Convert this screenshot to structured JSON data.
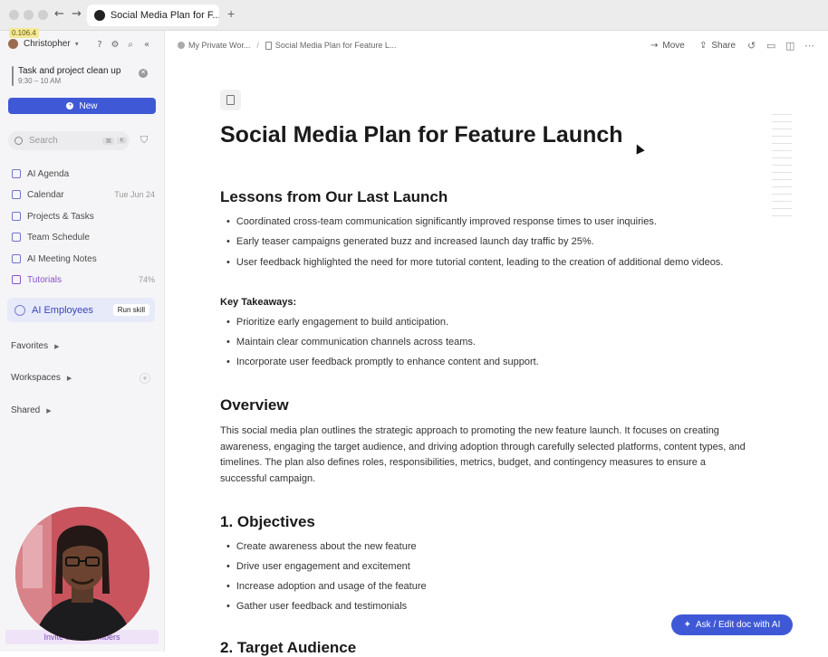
{
  "window": {
    "tab_title": "Social Media Plan for F..."
  },
  "sidebar": {
    "version": "0.106.4",
    "user_name": "Christopher",
    "event": {
      "title": "Task and project clean up",
      "time": "9:30 – 10 AM"
    },
    "new_button": "New",
    "search": {
      "placeholder": "Search",
      "kbd1": "⌘",
      "kbd2": "K"
    },
    "nav": [
      {
        "label": "AI Agenda",
        "meta": ""
      },
      {
        "label": "Calendar",
        "meta": "Tue Jun 24"
      },
      {
        "label": "Projects & Tasks",
        "meta": ""
      },
      {
        "label": "Team Schedule",
        "meta": ""
      },
      {
        "label": "AI Meeting Notes",
        "meta": ""
      },
      {
        "label": "Tutorials",
        "meta": "74%"
      }
    ],
    "ai_employees": {
      "label": "AI Employees",
      "run_skill": "Run skill"
    },
    "sections": {
      "favorites": "Favorites",
      "workspaces": "Workspaces",
      "shared": "Shared"
    },
    "invite": "Invite team members",
    "colors": {
      "accent": "#3f59d6",
      "tutorials": "#8a4fd1"
    }
  },
  "header": {
    "breadcrumb_workspace": "My Private Wor...",
    "breadcrumb_doc": "Social Media Plan for Feature L...",
    "move": "Move",
    "share": "Share"
  },
  "doc": {
    "title": "Social Media Plan for Feature Launch",
    "lessons_heading": "Lessons from Our Last Launch",
    "lessons": [
      "Coordinated cross-team communication significantly improved response times to user inquiries.",
      "Early teaser campaigns generated buzz and increased launch day traffic by 25%.",
      "User feedback highlighted the need for more tutorial content, leading to the creation of additional demo videos."
    ],
    "takeaways_heading": "Key Takeaways:",
    "takeaways": [
      "Prioritize early engagement to build anticipation.",
      "Maintain clear communication channels across teams.",
      "Incorporate user feedback promptly to enhance content and support."
    ],
    "overview_heading": "Overview",
    "overview_text": "This social media plan outlines the strategic approach to promoting the new feature launch. It focuses on creating awareness, engaging the target audience, and driving adoption through carefully selected platforms, content types, and timelines. The plan also defines roles, responsibilities, metrics, budget, and contingency measures to ensure a successful campaign.",
    "objectives_heading": "1. Objectives",
    "objectives": [
      "Create awareness about the new feature",
      "Drive user engagement and excitement",
      "Increase adoption and usage of the feature",
      "Gather user feedback and testimonials"
    ],
    "next_heading": "2. Target Audience"
  },
  "ask_ai": "Ask / Edit doc with AI"
}
